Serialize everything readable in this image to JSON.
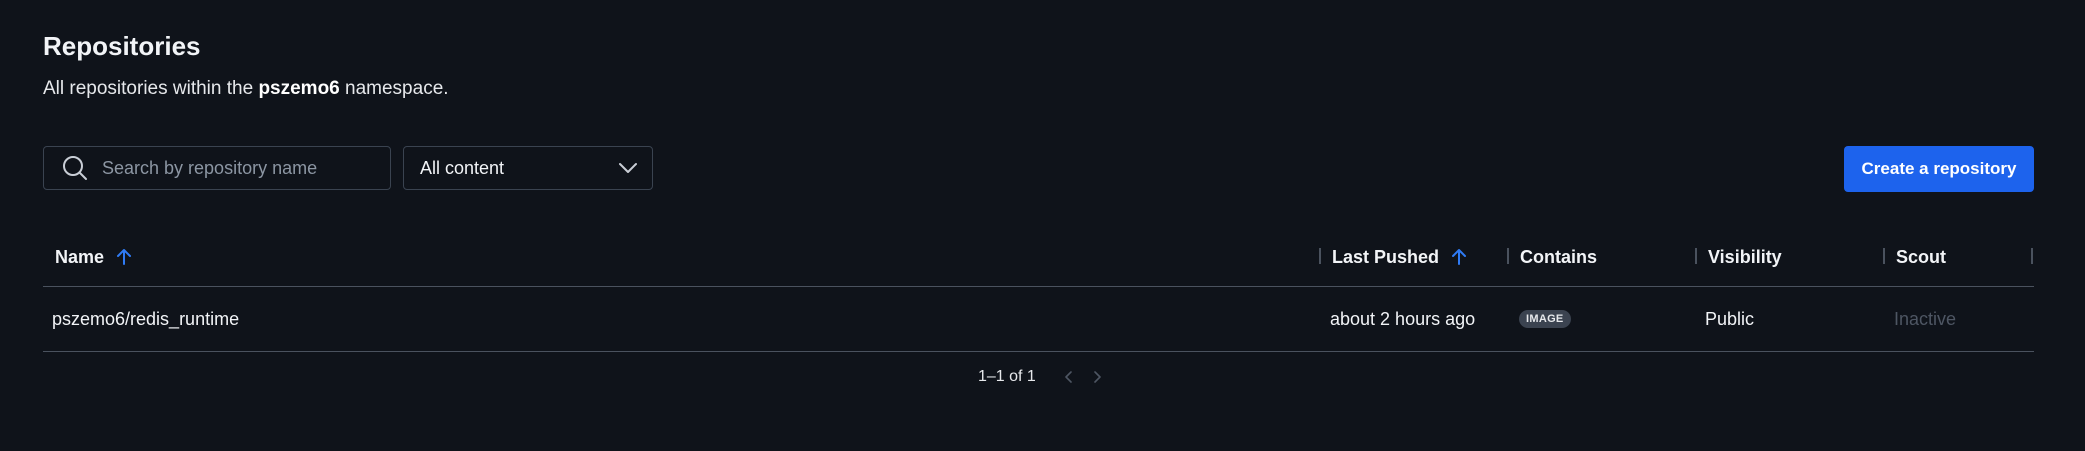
{
  "header": {
    "title": "Repositories",
    "subtitle_prefix": "All repositories within the ",
    "namespace": "pszemo6",
    "subtitle_suffix": " namespace."
  },
  "toolbar": {
    "search_placeholder": "Search by repository name",
    "search_value": "",
    "filter_selected": "All content",
    "create_label": "Create a repository"
  },
  "table": {
    "columns": {
      "name": "Name",
      "last_pushed": "Last Pushed",
      "contains": "Contains",
      "visibility": "Visibility",
      "scout": "Scout"
    },
    "rows": [
      {
        "name": "pszemo6/redis_runtime",
        "last_pushed": "about 2 hours ago",
        "contains": "IMAGE",
        "visibility": "Public",
        "scout": "Inactive"
      }
    ]
  },
  "pagination": {
    "range": "1–1 of 1"
  },
  "colors": {
    "background": "#0f131a",
    "accent": "#1d63ed",
    "sort_arrow": "#2f7bf5"
  },
  "icons": {
    "search": "search-icon",
    "dropdown": "chevron-down-icon",
    "sort": "arrow-up-icon",
    "prev": "chevron-left-icon",
    "next": "chevron-right-icon"
  }
}
